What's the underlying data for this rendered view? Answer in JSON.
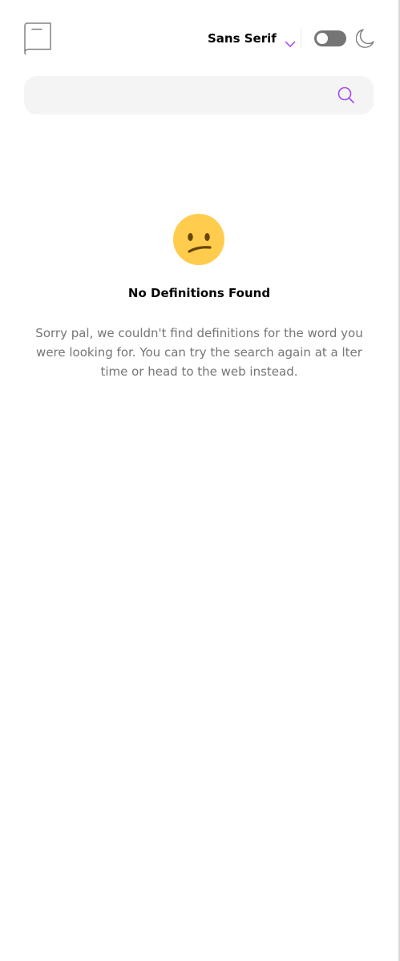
{
  "header": {
    "font_select": {
      "selected": "Sans Serif"
    },
    "theme_toggle": {
      "dark_mode": false
    }
  },
  "search": {
    "value": "",
    "placeholder": ""
  },
  "empty_state": {
    "title": "No Definitions Found",
    "message": "Sorry pal, we couldn't find definitions for the word you were looking for. You can try the search again at a lter time or head to the web instead."
  },
  "colors": {
    "accent": "#a445ed",
    "text_primary": "#050505",
    "text_secondary": "#757575",
    "search_background": "#f4f4f4",
    "toggle_track": "#757575",
    "icon_gray": "#838383",
    "emoji_face": "#ffcc4d",
    "emoji_features": "#664500"
  },
  "icons": {
    "logo": "book-icon",
    "chevron": "chevron-down-icon",
    "theme": "moon-icon",
    "search": "search-icon",
    "empty": "confused-face-emoji"
  }
}
